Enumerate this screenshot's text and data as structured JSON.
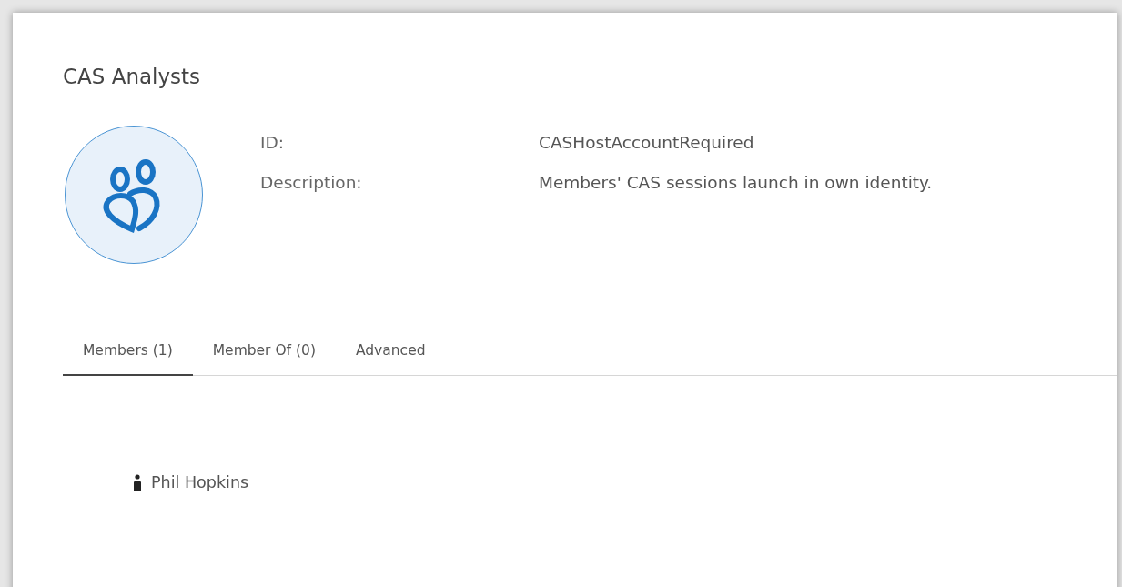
{
  "title": "CAS Analysts",
  "details": [
    {
      "label": "ID:",
      "value": "CASHostAccountRequired"
    },
    {
      "label": "Description:",
      "value": "Members' CAS sessions launch in own identity."
    }
  ],
  "tabs": [
    {
      "label": "Members (1)",
      "selected": true
    },
    {
      "label": "Member Of (0)",
      "selected": false
    },
    {
      "label": "Advanced",
      "selected": false
    }
  ],
  "members": [
    {
      "name": "Phil Hopkins"
    }
  ]
}
